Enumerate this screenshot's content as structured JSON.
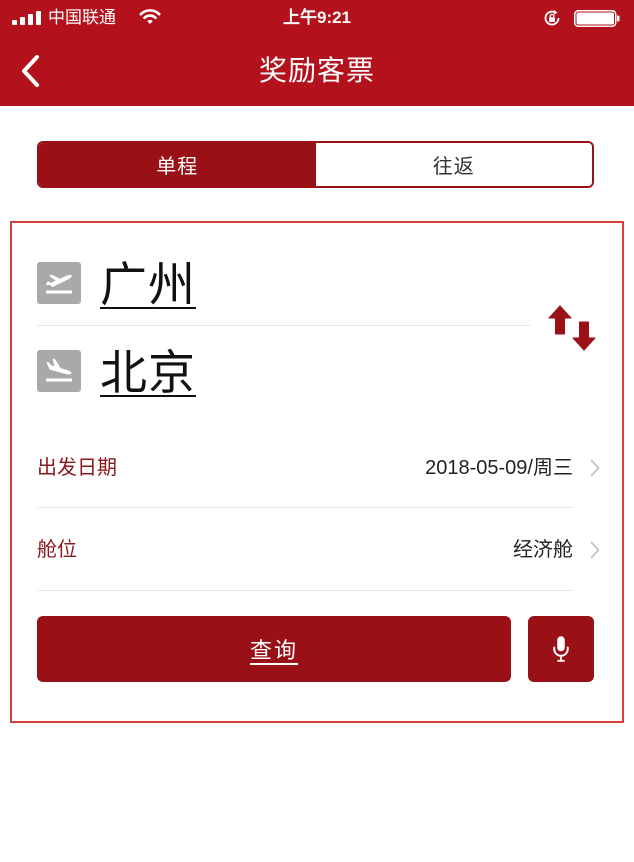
{
  "status_bar": {
    "carrier": "中国联通",
    "time": "上午9:21",
    "signal_bars": 4,
    "battery_level": 1.0,
    "signal_icon": "signal-icon",
    "wifi_icon": "wifi-icon",
    "lock_icon": "orientation-lock-icon",
    "battery_icon": "battery-icon"
  },
  "nav": {
    "title": "奖励客票",
    "back_icon": "back-chevron-icon"
  },
  "trip_type": {
    "tabs": [
      {
        "label": "单程",
        "active": true
      },
      {
        "label": "往返",
        "active": false
      }
    ]
  },
  "route": {
    "origin": "广州",
    "origin_icon": "takeoff-icon",
    "destination": "北京",
    "destination_icon": "landing-icon",
    "swap_icon": "swap-icon"
  },
  "fields": [
    {
      "label": "出发日期",
      "value": "2018-05-09/周三",
      "icon": "chevron-right-icon"
    },
    {
      "label": "舱位",
      "value": "经济舱",
      "icon": "chevron-right-icon"
    }
  ],
  "actions": {
    "search_label": "查询",
    "voice_icon": "microphone-icon"
  },
  "theme": {
    "brand_red": "#b3121c",
    "dark_red": "#9a1017",
    "card_border": "#d9413f",
    "label_red": "#8a1a1f",
    "icon_gray": "#a9a9a9"
  }
}
